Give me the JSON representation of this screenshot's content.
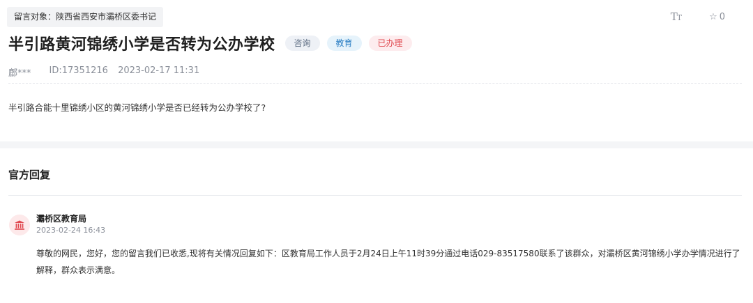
{
  "recipient": {
    "label": "留言对象：",
    "value": "陕西省西安市灞桥区委书记"
  },
  "toolbar": {
    "font_size_icon": "font-size-icon",
    "fav_icon": "star-outline-icon",
    "fav_count": "0"
  },
  "message": {
    "title": "半引路黄河锦绣小学是否转为公办学校",
    "tags": [
      {
        "label": "咨询",
        "color": "#5a6a80"
      },
      {
        "label": "教育",
        "color": "#2b7fc4"
      },
      {
        "label": "已办理",
        "color": "#e0484f"
      }
    ],
    "author": "鄜***",
    "id": "ID:17351216",
    "datetime": "2023-02-17 11:31",
    "content": "半引路合能十里锦绣小区的黄河锦绣小学是否已经转为公办学校了?"
  },
  "reply": {
    "heading": "官方回复",
    "org_icon": "government-building-icon",
    "org": "灞桥区教育局",
    "time": "2023-02-24 16:43",
    "body": "尊敬的网民，您好，您的留言我们已收悉,现将有关情况回复如下：区教育局工作人员于2月24日上午11时39分通过电话029-83517580联系了该群众，对灞桥区黄河锦绣小学办学情况进行了解释，群众表示满意。"
  }
}
